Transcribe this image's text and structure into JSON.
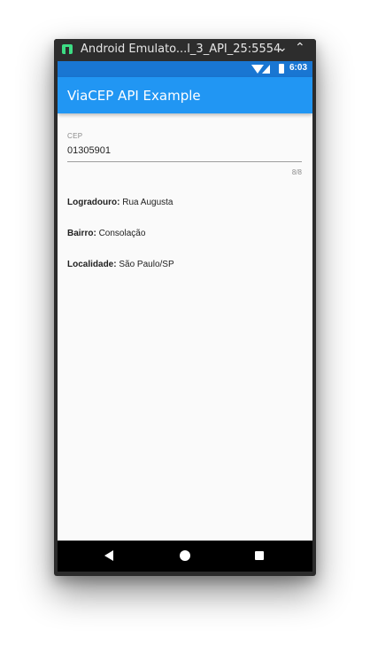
{
  "window": {
    "title": "Android Emulato...l_3_API_25:5554",
    "minimize_glyph": "⌄",
    "maximize_glyph": "⌃",
    "icon": "android-icon"
  },
  "statusbar": {
    "time": "6:03",
    "icons": [
      "wifi-icon",
      "signal-icon",
      "battery-icon"
    ]
  },
  "appbar": {
    "title": "ViaCEP API Example",
    "color": "#2196f3"
  },
  "cep_field": {
    "label": "CEP",
    "value": "01305901",
    "counter": "8/8"
  },
  "results": [
    {
      "label": "Logradouro:",
      "value": " Rua Augusta"
    },
    {
      "label": "Bairro:",
      "value": " Consolação"
    },
    {
      "label": "Localidade:",
      "value": " São Paulo/SP"
    }
  ],
  "navbar": {
    "icons": [
      "back-icon",
      "home-icon",
      "recents-icon"
    ]
  }
}
